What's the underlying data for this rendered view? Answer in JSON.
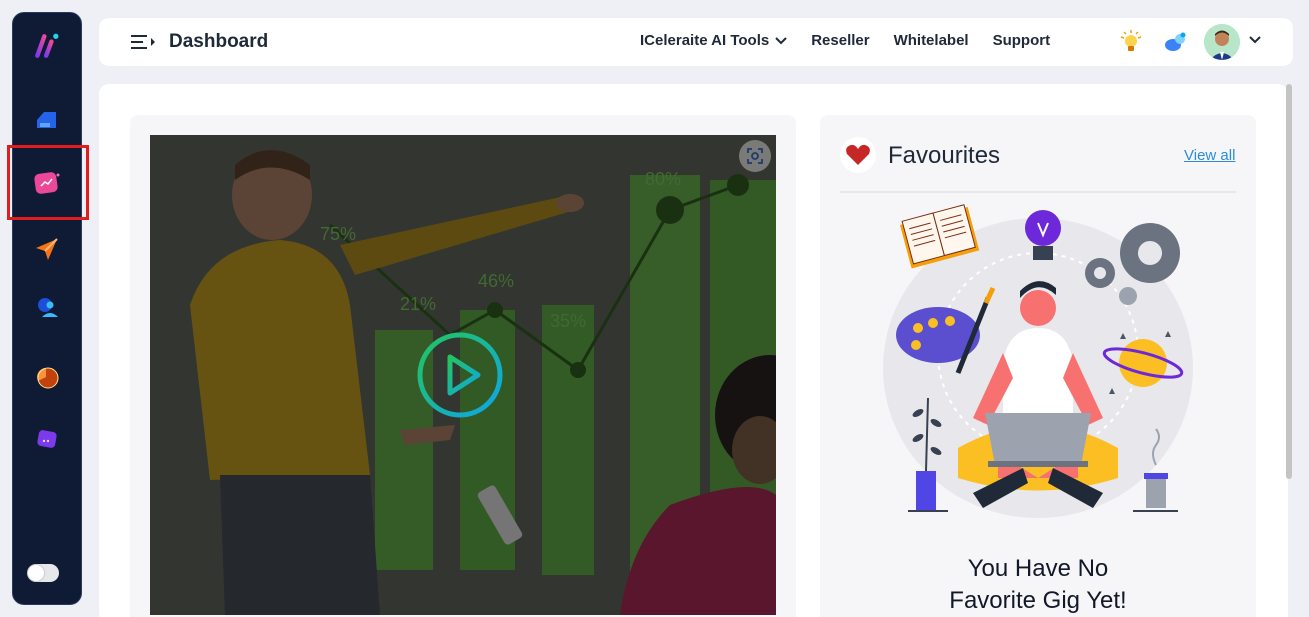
{
  "header": {
    "title": "Dashboard",
    "nav": [
      {
        "label": "ICeleraite AI Tools"
      },
      {
        "label": "Reseller"
      },
      {
        "label": "Whitelabel"
      },
      {
        "label": "Support"
      }
    ]
  },
  "favourites": {
    "title": "Favourites",
    "view_all": "View all",
    "empty_line1": "You Have No",
    "empty_line2": "Favorite Gig Yet!"
  },
  "video": {
    "chart_labels": [
      "75%",
      "21%",
      "46%",
      "35%",
      "80%"
    ]
  },
  "colors": {
    "sidebar_bg": "#0f1b35",
    "highlight": "#e11d1d",
    "link": "#2b8ed6",
    "page_bg": "#eff0f5"
  },
  "icons": {
    "sidebar": [
      "app-logo-icon",
      "home-icon",
      "analytics-icon",
      "send-icon",
      "user-search-icon",
      "pie-icon",
      "chat-icon"
    ],
    "topbar": [
      "menu-toggle-icon",
      "lightbulb-icon",
      "notifications-icon",
      "chevron-down-icon"
    ]
  }
}
